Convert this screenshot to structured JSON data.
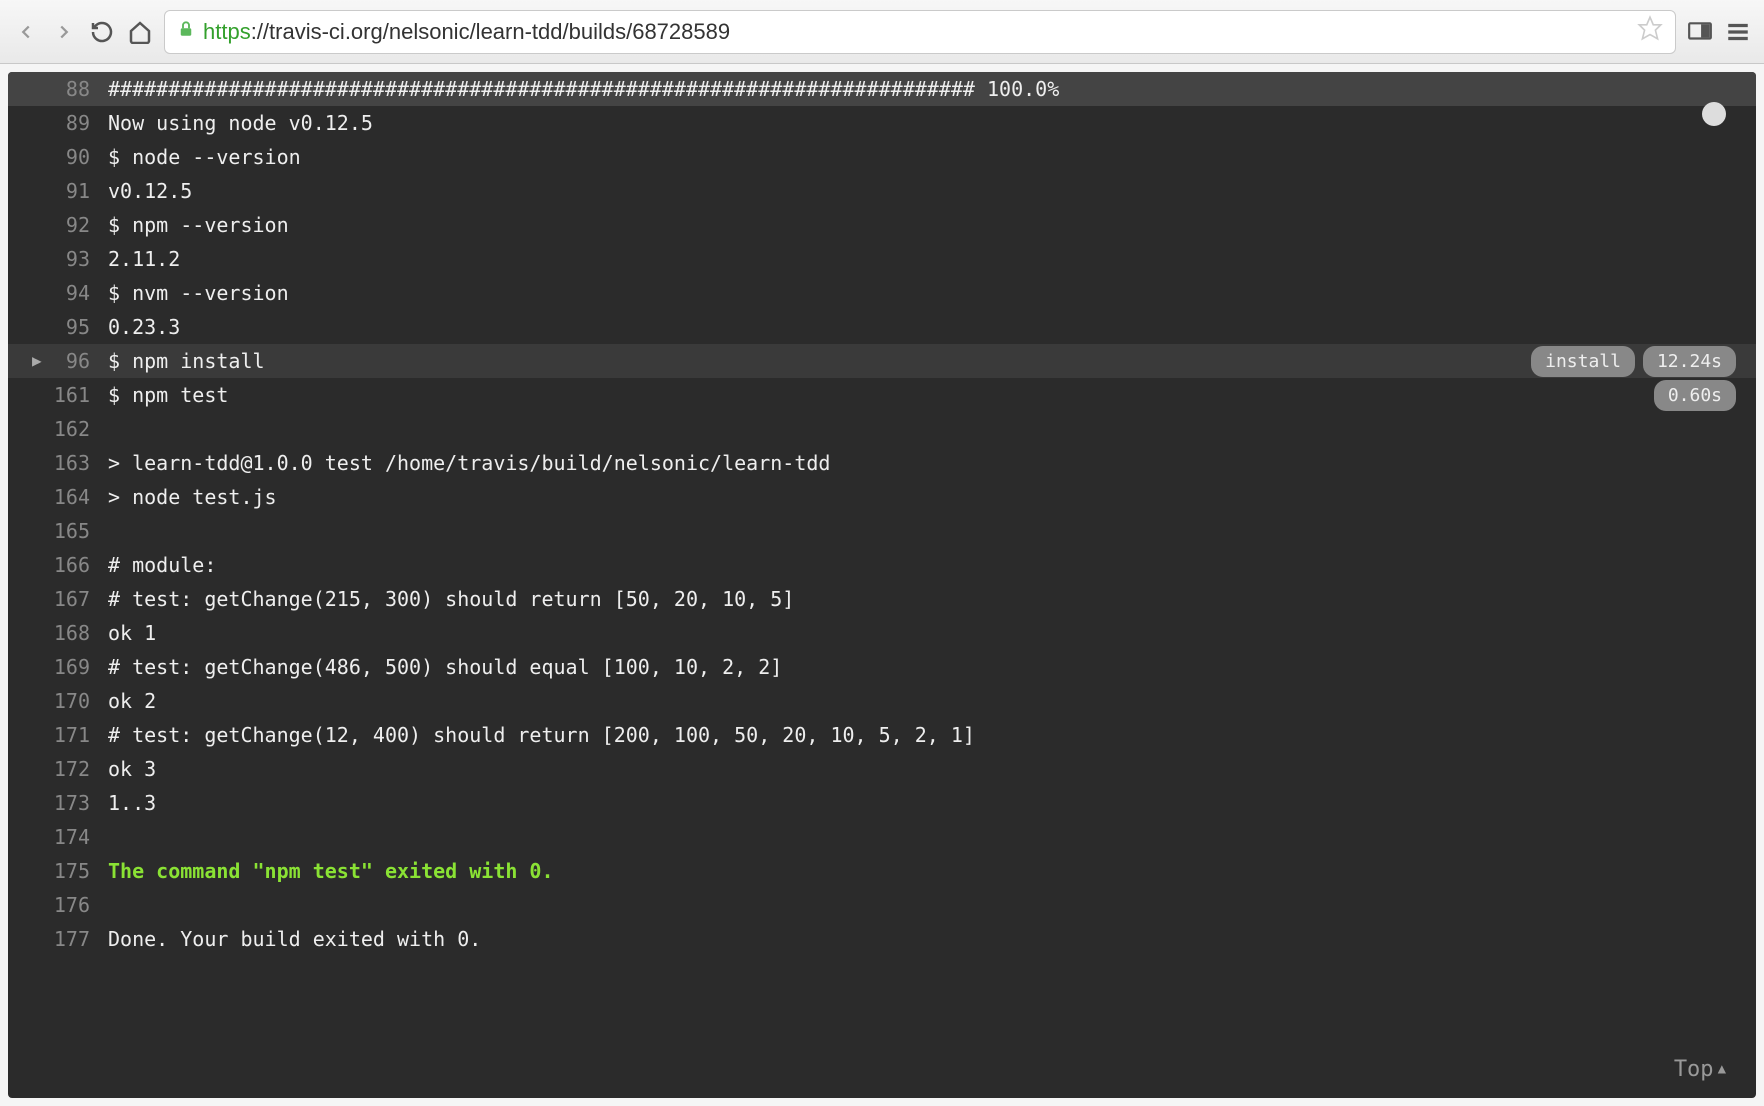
{
  "browser": {
    "url_https": "https",
    "url_domain": "://travis-ci.org",
    "url_path": "/nelsonic/learn-tdd/builds/68728589"
  },
  "log": {
    "lines": [
      {
        "num": "88",
        "text": "######################################################################## 100.0%",
        "highlighted": true
      },
      {
        "num": "89",
        "text": "Now using node v0.12.5"
      },
      {
        "num": "90",
        "text": "$ node --version"
      },
      {
        "num": "91",
        "text": "v0.12.5"
      },
      {
        "num": "92",
        "text": "$ npm --version"
      },
      {
        "num": "93",
        "text": "2.11.2"
      },
      {
        "num": "94",
        "text": "$ nvm --version"
      },
      {
        "num": "95",
        "text": "0.23.3"
      },
      {
        "num": "96",
        "text": "$ npm install",
        "fold": true,
        "foldLabel": "install",
        "duration": "12.24s"
      },
      {
        "num": "161",
        "text": "$ npm test",
        "duration": "0.60s"
      },
      {
        "num": "162",
        "text": ""
      },
      {
        "num": "163",
        "text": "> learn-tdd@1.0.0 test /home/travis/build/nelsonic/learn-tdd"
      },
      {
        "num": "164",
        "text": "> node test.js"
      },
      {
        "num": "165",
        "text": ""
      },
      {
        "num": "166",
        "text": "# module:"
      },
      {
        "num": "167",
        "text": "# test: getChange(215, 300) should return [50, 20, 10, 5]"
      },
      {
        "num": "168",
        "text": "ok 1"
      },
      {
        "num": "169",
        "text": "# test: getChange(486, 500) should equal [100, 10, 2, 2]"
      },
      {
        "num": "170",
        "text": "ok 2"
      },
      {
        "num": "171",
        "text": "# test: getChange(12, 400) should return [200, 100, 50, 20, 10, 5, 2, 1]"
      },
      {
        "num": "172",
        "text": "ok 3"
      },
      {
        "num": "173",
        "text": "1..3"
      },
      {
        "num": "174",
        "text": ""
      },
      {
        "num": "175",
        "text": "The command \"npm test\" exited with 0.",
        "green": true
      },
      {
        "num": "176",
        "text": ""
      },
      {
        "num": "177",
        "text": "Done. Your build exited with 0."
      }
    ]
  },
  "topButton": {
    "label": "Top"
  }
}
